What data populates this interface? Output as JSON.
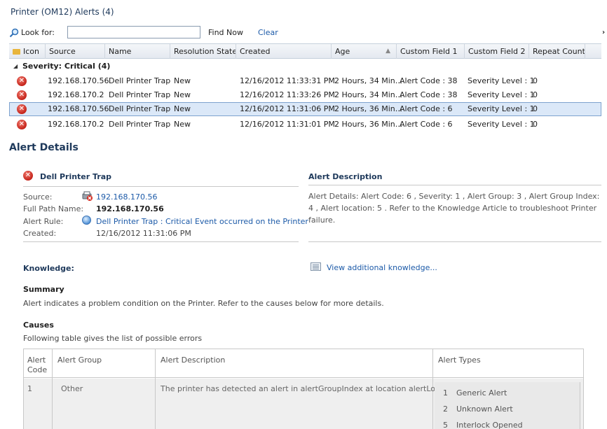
{
  "window": {
    "title": "Printer (OM12) Alerts (4)"
  },
  "search": {
    "label": "Look for:",
    "value": "",
    "find_now": "Find Now",
    "clear": "Clear"
  },
  "grid": {
    "columns": [
      "Icon",
      "Source",
      "Name",
      "Resolution State",
      "Created",
      "Age",
      "Custom Field 1",
      "Custom Field 2",
      "Repeat Count"
    ],
    "group_label": "Severity: Critical (4)",
    "rows": [
      {
        "source": "192.168.170.56",
        "name": "Dell Printer Trap",
        "state": "New",
        "created": "12/16/2012 11:33:31 PM",
        "age": "2 Hours, 34 Min...",
        "cf1": "Alert Code : 38",
        "cf2": "Severity Level : 1",
        "repeat": "0",
        "selected": false
      },
      {
        "source": "192.168.170.2",
        "name": "Dell Printer Trap",
        "state": "New",
        "created": "12/16/2012 11:33:26 PM",
        "age": "2 Hours, 34 Min...",
        "cf1": "Alert Code : 38",
        "cf2": "Severity Level : 1",
        "repeat": "0",
        "selected": false
      },
      {
        "source": "192.168.170.56",
        "name": "Dell Printer Trap",
        "state": "New",
        "created": "12/16/2012 11:31:06 PM",
        "age": "2 Hours, 36 Min...",
        "cf1": "Alert Code : 6",
        "cf2": "Severity Level : 1",
        "repeat": "0",
        "selected": true
      },
      {
        "source": "192.168.170.2",
        "name": "Dell Printer Trap",
        "state": "New",
        "created": "12/16/2012 11:31:01 PM",
        "age": "2 Hours, 36 Min...",
        "cf1": "Alert Code : 6",
        "cf2": "Severity Level : 1",
        "repeat": "0",
        "selected": false
      }
    ]
  },
  "details": {
    "title": "Alert Details",
    "alert_name": "Dell Printer Trap",
    "source_label": "Source:",
    "source_value": "192.168.170.56",
    "full_path_label": "Full Path Name:",
    "full_path_value": "192.168.170.56",
    "alert_rule_label": "Alert Rule:",
    "alert_rule_value": "Dell Printer Trap : Critical Event occurred on the Printer",
    "created_label": "Created:",
    "created_value": "12/16/2012 11:31:06 PM",
    "description_title": "Alert Description",
    "description_text": "Alert Details: Alert Code: 6 , Severity: 1 , Alert Group: 3 , Alert Group Index: 4 , Alert location: 5 . Refer to the Knowledge Article to troubleshoot Printer failure.",
    "knowledge_title": "Knowledge:",
    "knowledge_link": "View additional knowledge...",
    "summary_title": "Summary",
    "summary_text": "Alert indicates a problem condition on the Printer. Refer to the causes below for more details.",
    "causes_title": "Causes",
    "causes_text": "Following table gives the list of possible errors"
  },
  "causes_table": {
    "headers": {
      "code_line1": "Alert",
      "code_line2": "Code",
      "group": "Alert Group",
      "description": "Alert Description",
      "types": "Alert Types"
    },
    "row": {
      "code": "1",
      "group": "Other",
      "description": "The printer has detected an alert in alertGroupIndex at location alertLocation.",
      "types": [
        {
          "num": "1",
          "label": "Generic Alert"
        },
        {
          "num": "2",
          "label": "Unknown Alert"
        },
        {
          "num": "5",
          "label": "Interlock Opened"
        }
      ]
    }
  },
  "colors": {
    "link": "#1c5aa8",
    "heading": "#1e395b",
    "selected_row": "#dbe8f8",
    "error_icon": "#c4231a"
  }
}
